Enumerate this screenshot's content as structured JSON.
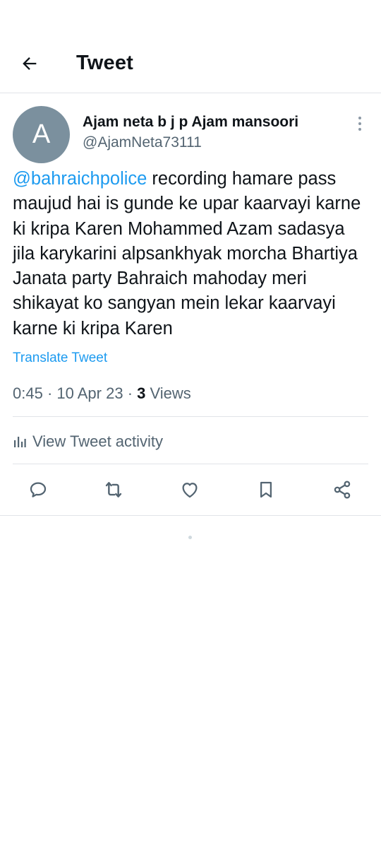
{
  "header": {
    "title": "Tweet",
    "back_icon": "arrow-left-icon"
  },
  "tweet": {
    "avatar_letter": "A",
    "avatar_color": "#7b909e",
    "display_name": "Ajam neta b j p Ajam mansoori",
    "handle": "@AjamNeta73111",
    "mention": "@bahraichpolice",
    "body": " recording hamare pass maujud hai is gunde ke upar kaarvayi karne ki kripa Karen Mohammed Azam sadasya jila karykarini alpsankhyak morcha Bhartiya Janata party Bahraich mahoday meri shikayat ko sangyan mein lekar kaarvayi karne ki kripa Karen",
    "translate_label": "Translate Tweet",
    "time": "0:45",
    "date": "10 Apr 23",
    "views_count": "3",
    "views_label": " Views",
    "separator": " · ",
    "activity_label": "View Tweet activity"
  },
  "actions": [
    {
      "name": "reply",
      "icon": "reply-icon"
    },
    {
      "name": "retweet",
      "icon": "retweet-icon"
    },
    {
      "name": "like",
      "icon": "heart-icon"
    },
    {
      "name": "bookmark",
      "icon": "bookmark-icon"
    },
    {
      "name": "share",
      "icon": "share-icon"
    }
  ],
  "colors": {
    "accent": "#1d9bf0",
    "text_primary": "#0f1419",
    "text_secondary": "#536471",
    "divider": "#e1e4e8"
  }
}
